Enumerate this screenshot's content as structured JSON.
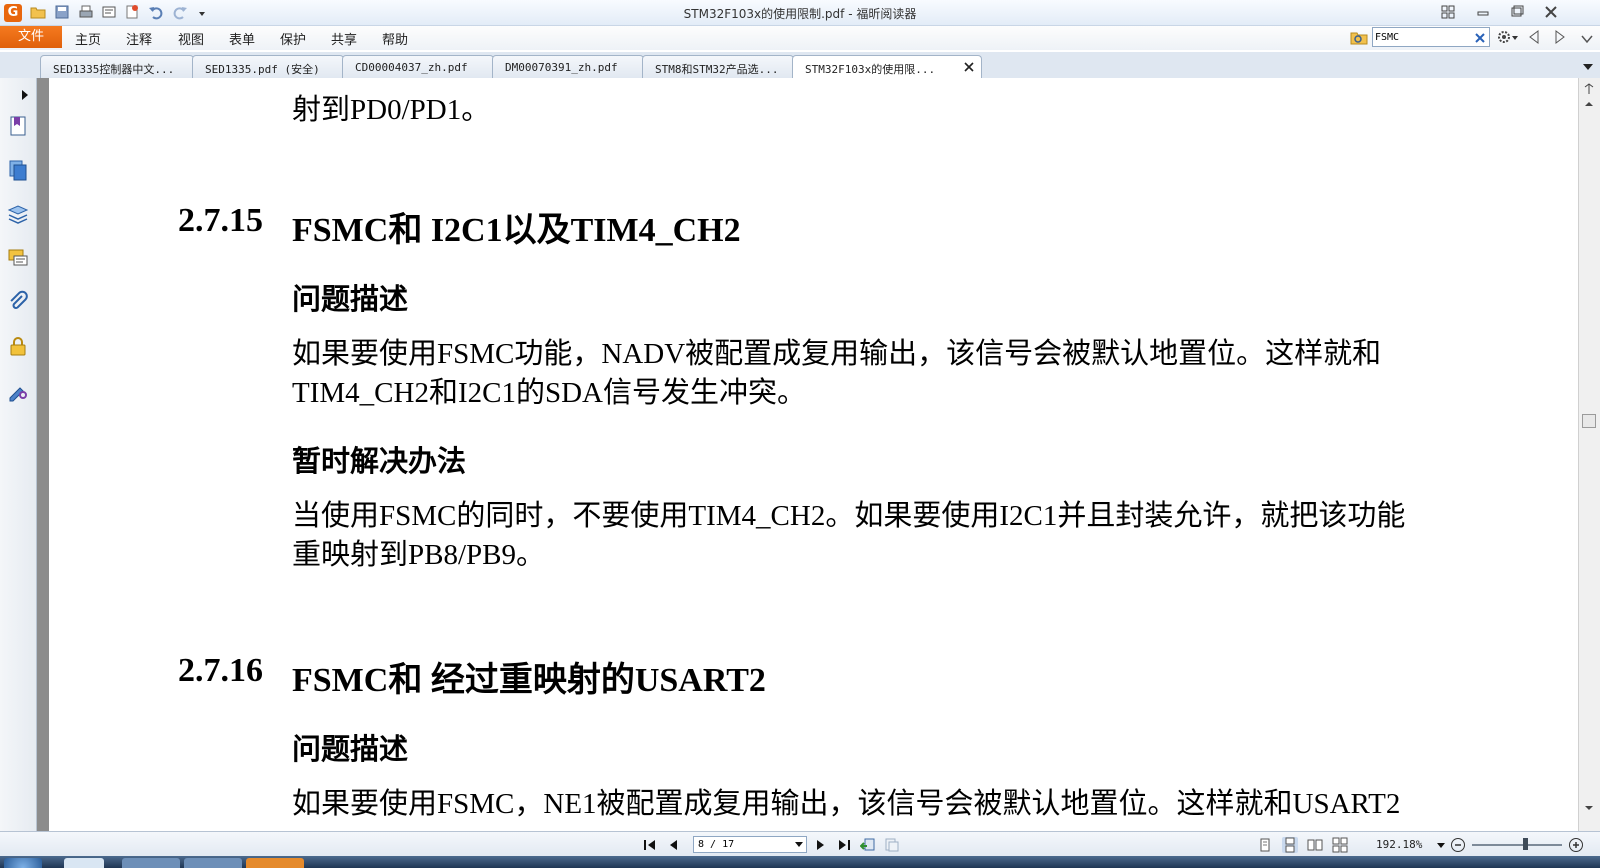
{
  "window": {
    "title": "STM32F103x的使用限制.pdf - 福昕阅读器"
  },
  "menu": {
    "file": "文件",
    "items": [
      "主页",
      "注释",
      "视图",
      "表单",
      "保护",
      "共享",
      "帮助"
    ]
  },
  "search": {
    "value": "FSMC"
  },
  "tabs": [
    {
      "label": "SED1335控制器中文...",
      "active": false
    },
    {
      "label": "SED1335.pdf (安全)",
      "active": false
    },
    {
      "label": "CD00004037_zh.pdf",
      "active": false
    },
    {
      "label": "DM00070391_zh.pdf",
      "active": false
    },
    {
      "label": "STM8和STM32产品选...",
      "active": false
    },
    {
      "label": "STM32F103x的使用限...",
      "active": true
    }
  ],
  "sidebar_icons": [
    "bookmarks-icon",
    "pages-icon",
    "layers-icon",
    "comments-icon",
    "attachments-icon",
    "security-icon",
    "signatures-icon"
  ],
  "document": {
    "top_fragment": "射到PD0/PD1。",
    "section_15": {
      "number": "2.7.15",
      "title": "FSMC和 I2C1以及TIM4_CH2",
      "problem_heading": "问题描述",
      "problem_line1": "如果要使用FSMC功能，NADV被配置成复用输出，该信号会被默认地置位。这样就和",
      "problem_line2": "TIM4_CH2和I2C1的SDA信号发生冲突。",
      "workaround_heading": "暂时解决办法",
      "workaround_line1": "当使用FSMC的同时，不要使用TIM4_CH2。如果要使用I2C1并且封装允许，就把该功能",
      "workaround_line2": "重映射到PB8/PB9。"
    },
    "section_16": {
      "number": "2.7.16",
      "title": "FSMC和 经过重映射的USART2",
      "problem_heading": "问题描述",
      "problem_line1": "如果要使用FSMC，NE1被配置成复用输出，该信号会被默认地置位。这样就和USART2"
    }
  },
  "status": {
    "page_indicator": "8 / 17",
    "zoom": "192.18%"
  },
  "colors": {
    "accent_orange": "#e8660d",
    "chrome_blue": "#dfe7f1"
  }
}
